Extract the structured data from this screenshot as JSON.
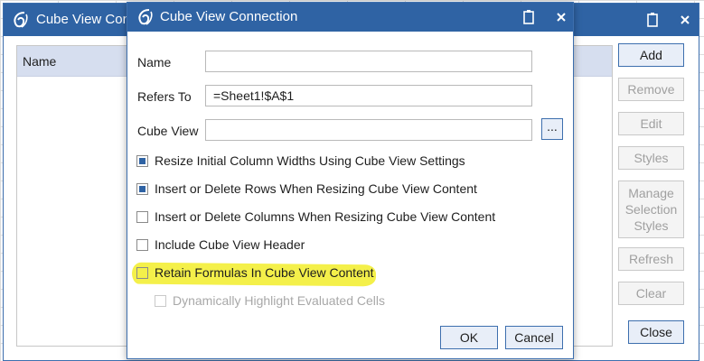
{
  "back_dialog": {
    "title": "Cube View Connections",
    "title_visible": "Cube View Con",
    "list_header": "Name",
    "buttons": {
      "add": "Add",
      "remove": "Remove",
      "edit": "Edit",
      "styles": "Styles",
      "manage_line1": "Manage",
      "manage_line2": "Selection",
      "manage_line3": "Styles",
      "refresh": "Refresh",
      "clear": "Clear",
      "close": "Close"
    },
    "icons": {
      "logo": "onestream-logo-icon",
      "clipboard": "clipboard-icon",
      "close": "close-icon"
    }
  },
  "dialog": {
    "title": "Cube View Connection",
    "icons": {
      "logo": "onestream-logo-icon",
      "clipboard": "clipboard-icon",
      "close": "close-icon"
    },
    "fields": {
      "name_label": "Name",
      "name_value": "",
      "refers_to_label": "Refers To",
      "refers_to_value": "=Sheet1!$A$1",
      "cube_view_label": "Cube View",
      "cube_view_value": "",
      "browse_label": "..."
    },
    "checkboxes": [
      {
        "label": "Resize Initial Column Widths Using Cube View Settings",
        "checked": true,
        "enabled": true
      },
      {
        "label": "Insert or Delete Rows When Resizing Cube View Content",
        "checked": true,
        "enabled": true
      },
      {
        "label": "Insert or Delete Columns When Resizing Cube View Content",
        "checked": false,
        "enabled": true
      },
      {
        "label": "Include Cube View Header",
        "checked": false,
        "enabled": true
      },
      {
        "label": "Retain Formulas In Cube View Content",
        "checked": false,
        "enabled": true,
        "highlighted": true
      },
      {
        "label": "Dynamically Highlight Evaluated Cells",
        "checked": false,
        "enabled": false
      }
    ],
    "buttons": {
      "ok": "OK",
      "cancel": "Cancel"
    }
  },
  "colors": {
    "titlebar": "#2f63a4",
    "highlight": "#f4f04a",
    "checkbox_fill": "#2f63a4"
  }
}
